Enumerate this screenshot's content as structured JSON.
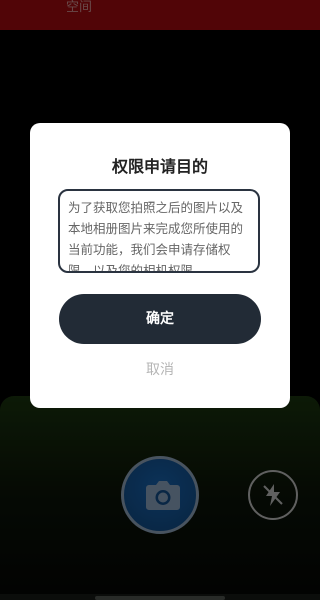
{
  "header": {
    "title": "空间"
  },
  "dialog": {
    "title": "权限申请目的",
    "body": "为了获取您拍照之后的图片以及本地相册图片来完成您所使用的当前功能，我们会申请存储权限，以及您的相机权限",
    "confirm_label": "确定",
    "cancel_label": "取消"
  },
  "camera": {
    "shutter_icon": "camera-icon",
    "flash_icon": "flash-off-icon"
  },
  "colors": {
    "top_bar": "#b40c10",
    "confirm_button": "#222b36",
    "shutter": "#1a6fc4"
  }
}
